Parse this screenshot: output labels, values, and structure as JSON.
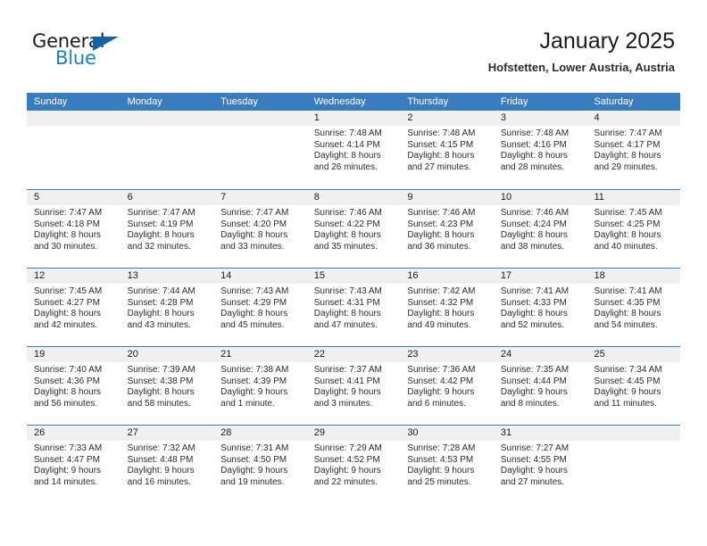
{
  "brand": {
    "name_part1": "General",
    "name_part2": "Blue",
    "accent_color": "#1a7fc1",
    "triangle_color": "#1464a5"
  },
  "header": {
    "title": "January 2025",
    "subtitle": "Hofstetten, Lower Austria, Austria"
  },
  "theme": {
    "header_row_bg": "#3a7dbf",
    "day_number_bg": "#f0f0f0",
    "divider_color": "#3a7dbf"
  },
  "weekdays": [
    "Sunday",
    "Monday",
    "Tuesday",
    "Wednesday",
    "Thursday",
    "Friday",
    "Saturday"
  ],
  "weeks": [
    [
      {
        "day": "",
        "lines": []
      },
      {
        "day": "",
        "lines": []
      },
      {
        "day": "",
        "lines": []
      },
      {
        "day": "1",
        "lines": [
          "Sunrise: 7:48 AM",
          "Sunset: 4:14 PM",
          "Daylight: 8 hours",
          "and 26 minutes."
        ]
      },
      {
        "day": "2",
        "lines": [
          "Sunrise: 7:48 AM",
          "Sunset: 4:15 PM",
          "Daylight: 8 hours",
          "and 27 minutes."
        ]
      },
      {
        "day": "3",
        "lines": [
          "Sunrise: 7:48 AM",
          "Sunset: 4:16 PM",
          "Daylight: 8 hours",
          "and 28 minutes."
        ]
      },
      {
        "day": "4",
        "lines": [
          "Sunrise: 7:47 AM",
          "Sunset: 4:17 PM",
          "Daylight: 8 hours",
          "and 29 minutes."
        ]
      }
    ],
    [
      {
        "day": "5",
        "lines": [
          "Sunrise: 7:47 AM",
          "Sunset: 4:18 PM",
          "Daylight: 8 hours",
          "and 30 minutes."
        ]
      },
      {
        "day": "6",
        "lines": [
          "Sunrise: 7:47 AM",
          "Sunset: 4:19 PM",
          "Daylight: 8 hours",
          "and 32 minutes."
        ]
      },
      {
        "day": "7",
        "lines": [
          "Sunrise: 7:47 AM",
          "Sunset: 4:20 PM",
          "Daylight: 8 hours",
          "and 33 minutes."
        ]
      },
      {
        "day": "8",
        "lines": [
          "Sunrise: 7:46 AM",
          "Sunset: 4:22 PM",
          "Daylight: 8 hours",
          "and 35 minutes."
        ]
      },
      {
        "day": "9",
        "lines": [
          "Sunrise: 7:46 AM",
          "Sunset: 4:23 PM",
          "Daylight: 8 hours",
          "and 36 minutes."
        ]
      },
      {
        "day": "10",
        "lines": [
          "Sunrise: 7:46 AM",
          "Sunset: 4:24 PM",
          "Daylight: 8 hours",
          "and 38 minutes."
        ]
      },
      {
        "day": "11",
        "lines": [
          "Sunrise: 7:45 AM",
          "Sunset: 4:25 PM",
          "Daylight: 8 hours",
          "and 40 minutes."
        ]
      }
    ],
    [
      {
        "day": "12",
        "lines": [
          "Sunrise: 7:45 AM",
          "Sunset: 4:27 PM",
          "Daylight: 8 hours",
          "and 42 minutes."
        ]
      },
      {
        "day": "13",
        "lines": [
          "Sunrise: 7:44 AM",
          "Sunset: 4:28 PM",
          "Daylight: 8 hours",
          "and 43 minutes."
        ]
      },
      {
        "day": "14",
        "lines": [
          "Sunrise: 7:43 AM",
          "Sunset: 4:29 PM",
          "Daylight: 8 hours",
          "and 45 minutes."
        ]
      },
      {
        "day": "15",
        "lines": [
          "Sunrise: 7:43 AM",
          "Sunset: 4:31 PM",
          "Daylight: 8 hours",
          "and 47 minutes."
        ]
      },
      {
        "day": "16",
        "lines": [
          "Sunrise: 7:42 AM",
          "Sunset: 4:32 PM",
          "Daylight: 8 hours",
          "and 49 minutes."
        ]
      },
      {
        "day": "17",
        "lines": [
          "Sunrise: 7:41 AM",
          "Sunset: 4:33 PM",
          "Daylight: 8 hours",
          "and 52 minutes."
        ]
      },
      {
        "day": "18",
        "lines": [
          "Sunrise: 7:41 AM",
          "Sunset: 4:35 PM",
          "Daylight: 8 hours",
          "and 54 minutes."
        ]
      }
    ],
    [
      {
        "day": "19",
        "lines": [
          "Sunrise: 7:40 AM",
          "Sunset: 4:36 PM",
          "Daylight: 8 hours",
          "and 56 minutes."
        ]
      },
      {
        "day": "20",
        "lines": [
          "Sunrise: 7:39 AM",
          "Sunset: 4:38 PM",
          "Daylight: 8 hours",
          "and 58 minutes."
        ]
      },
      {
        "day": "21",
        "lines": [
          "Sunrise: 7:38 AM",
          "Sunset: 4:39 PM",
          "Daylight: 9 hours",
          "and 1 minute."
        ]
      },
      {
        "day": "22",
        "lines": [
          "Sunrise: 7:37 AM",
          "Sunset: 4:41 PM",
          "Daylight: 9 hours",
          "and 3 minutes."
        ]
      },
      {
        "day": "23",
        "lines": [
          "Sunrise: 7:36 AM",
          "Sunset: 4:42 PM",
          "Daylight: 9 hours",
          "and 6 minutes."
        ]
      },
      {
        "day": "24",
        "lines": [
          "Sunrise: 7:35 AM",
          "Sunset: 4:44 PM",
          "Daylight: 9 hours",
          "and 8 minutes."
        ]
      },
      {
        "day": "25",
        "lines": [
          "Sunrise: 7:34 AM",
          "Sunset: 4:45 PM",
          "Daylight: 9 hours",
          "and 11 minutes."
        ]
      }
    ],
    [
      {
        "day": "26",
        "lines": [
          "Sunrise: 7:33 AM",
          "Sunset: 4:47 PM",
          "Daylight: 9 hours",
          "and 14 minutes."
        ]
      },
      {
        "day": "27",
        "lines": [
          "Sunrise: 7:32 AM",
          "Sunset: 4:48 PM",
          "Daylight: 9 hours",
          "and 16 minutes."
        ]
      },
      {
        "day": "28",
        "lines": [
          "Sunrise: 7:31 AM",
          "Sunset: 4:50 PM",
          "Daylight: 9 hours",
          "and 19 minutes."
        ]
      },
      {
        "day": "29",
        "lines": [
          "Sunrise: 7:29 AM",
          "Sunset: 4:52 PM",
          "Daylight: 9 hours",
          "and 22 minutes."
        ]
      },
      {
        "day": "30",
        "lines": [
          "Sunrise: 7:28 AM",
          "Sunset: 4:53 PM",
          "Daylight: 9 hours",
          "and 25 minutes."
        ]
      },
      {
        "day": "31",
        "lines": [
          "Sunrise: 7:27 AM",
          "Sunset: 4:55 PM",
          "Daylight: 9 hours",
          "and 27 minutes."
        ]
      },
      {
        "day": "",
        "lines": []
      }
    ]
  ]
}
